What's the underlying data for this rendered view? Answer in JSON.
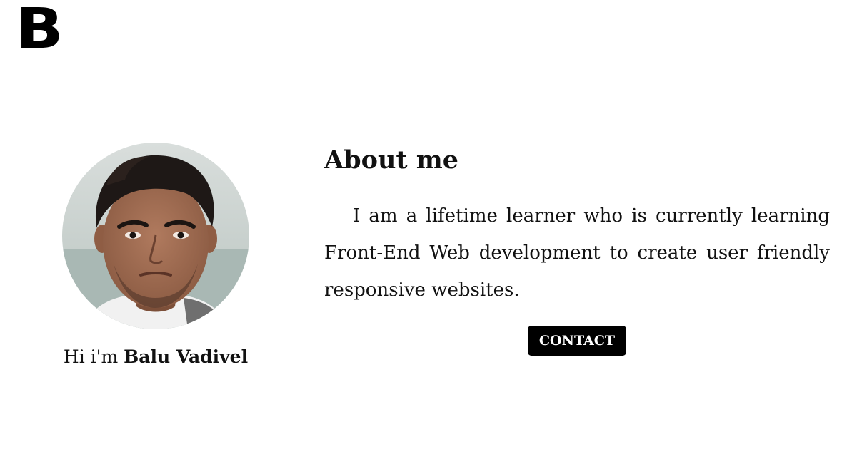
{
  "logo": {
    "text": "B"
  },
  "profile": {
    "greeting_prefix": "Hi i'm ",
    "name": "Balu Vadivel"
  },
  "about": {
    "heading": "About me",
    "paragraph": "I am a lifetime learner who is currently learning Front-End Web development to create user friendly responsive websites.",
    "contact_label": "CONTACT"
  },
  "colors": {
    "background": "#ffffff",
    "text": "#111111",
    "button_bg": "#000000",
    "button_text": "#ffffff"
  }
}
